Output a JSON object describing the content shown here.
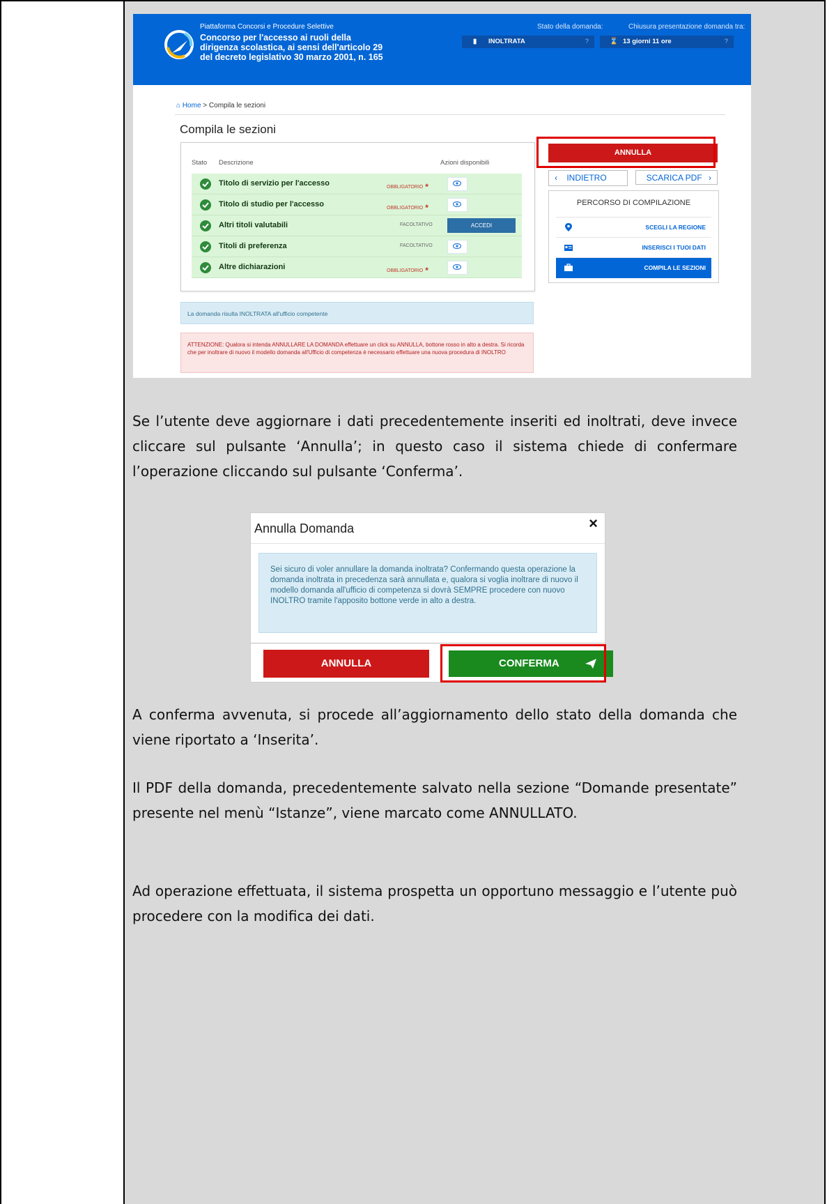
{
  "screenshot1": {
    "header": {
      "platform": "Piattaforma Concorsi e Procedure Selettive",
      "title": "Concorso per l'accesso ai ruoli della dirigenza scolastica, ai sensi dell'articolo 29 del decreto legislativo 30 marzo 2001, n. 165",
      "stato_label": "Stato della domanda:",
      "stato_value": "INOLTRATA",
      "chiusura_label": "Chiusura presentazione domanda tra:",
      "chiusura_value": "13 giorni 11 ore",
      "help": "?"
    },
    "breadcrumb": {
      "home": "Home",
      "sep": ">",
      "current": "Compila le sezioni"
    },
    "page_title": "Compila le sezioni",
    "table": {
      "headers": {
        "stato": "Stato",
        "descrizione": "Descrizione",
        "azioni": "Azioni disponibili"
      },
      "rows": [
        {
          "desc": "Titolo di servizio per l'accesso",
          "tipo": "OBBLIGATORIO",
          "star": "*",
          "action": "view"
        },
        {
          "desc": "Titolo di studio per l'accesso",
          "tipo": "OBBLIGATORIO",
          "star": "*",
          "action": "view"
        },
        {
          "desc": "Altri titoli valutabili",
          "tipo": "FACOLTATIVO",
          "star": "",
          "action": "ACCEDI"
        },
        {
          "desc": "Titoli di preferenza",
          "tipo": "FACOLTATIVO",
          "star": "",
          "action": "view"
        },
        {
          "desc": "Altre dichiarazioni",
          "tipo": "OBBLIGATORIO",
          "star": "*",
          "action": "view"
        }
      ]
    },
    "buttons": {
      "annulla": "ANNULLA",
      "indietro": "INDIETRO",
      "scarica": "SCARICA PDF"
    },
    "percorso": {
      "title": "PERCORSO DI COMPILAZIONE",
      "items": [
        "SCEGLI LA REGIONE",
        "INSERISCI I TUOI DATI",
        "COMPILA LE SEZIONI"
      ]
    },
    "info": "La domanda risulta INOLTRATA all'ufficio competente",
    "warning": "ATTENZIONE: Qualora si intenda ANNULLARE LA DOMANDA effettuare un click su ANNULLA, bottone rosso in alto a destra. Si ricorda che per inoltrare di nuovo il modello domanda all'Ufficio di competenza è necessario effettuare una nuova procedura di INOLTRO"
  },
  "paragraphs": {
    "p1": "Se l’utente deve aggiornare i dati precedentemente inseriti ed inoltrati, deve invece cliccare sul pulsante ‘Annulla’; in questo caso il sistema chiede di confermare l’operazione cliccando sul pulsante ‘Conferma’.",
    "p2": "A conferma avvenuta, si procede all’aggiornamento dello stato della domanda che viene riportato a ‘Inserita’.",
    "p3": "Il PDF della domanda, precedentemente salvato nella sezione “Domande presentate” presente nel menù “Istanze”, viene marcato come ANNULLATO.",
    "p4": "Ad operazione effettuata, il sistema prospetta un opportuno messaggio e l’utente può procedere con la modifica dei dati."
  },
  "dialog": {
    "title": "Annulla Domanda",
    "close": "×",
    "message": "Sei sicuro di voler annullare la domanda inoltrata? Confermando questa operazione la domanda inoltrata in precedenza sarà annullata e, qualora si voglia inoltrare di nuovo il modello domanda all'ufficio di competenza si dovrà SEMPRE procedere con nuovo INOLTRO tramite l'apposito bottone verde in alto a destra.",
    "annulla": "ANNULLA",
    "conferma": "CONFERMA"
  },
  "colors": {
    "header_blue": "#0366d6",
    "danger": "#cc1818",
    "success": "#1a8a1f",
    "highlight": "#e00000"
  }
}
